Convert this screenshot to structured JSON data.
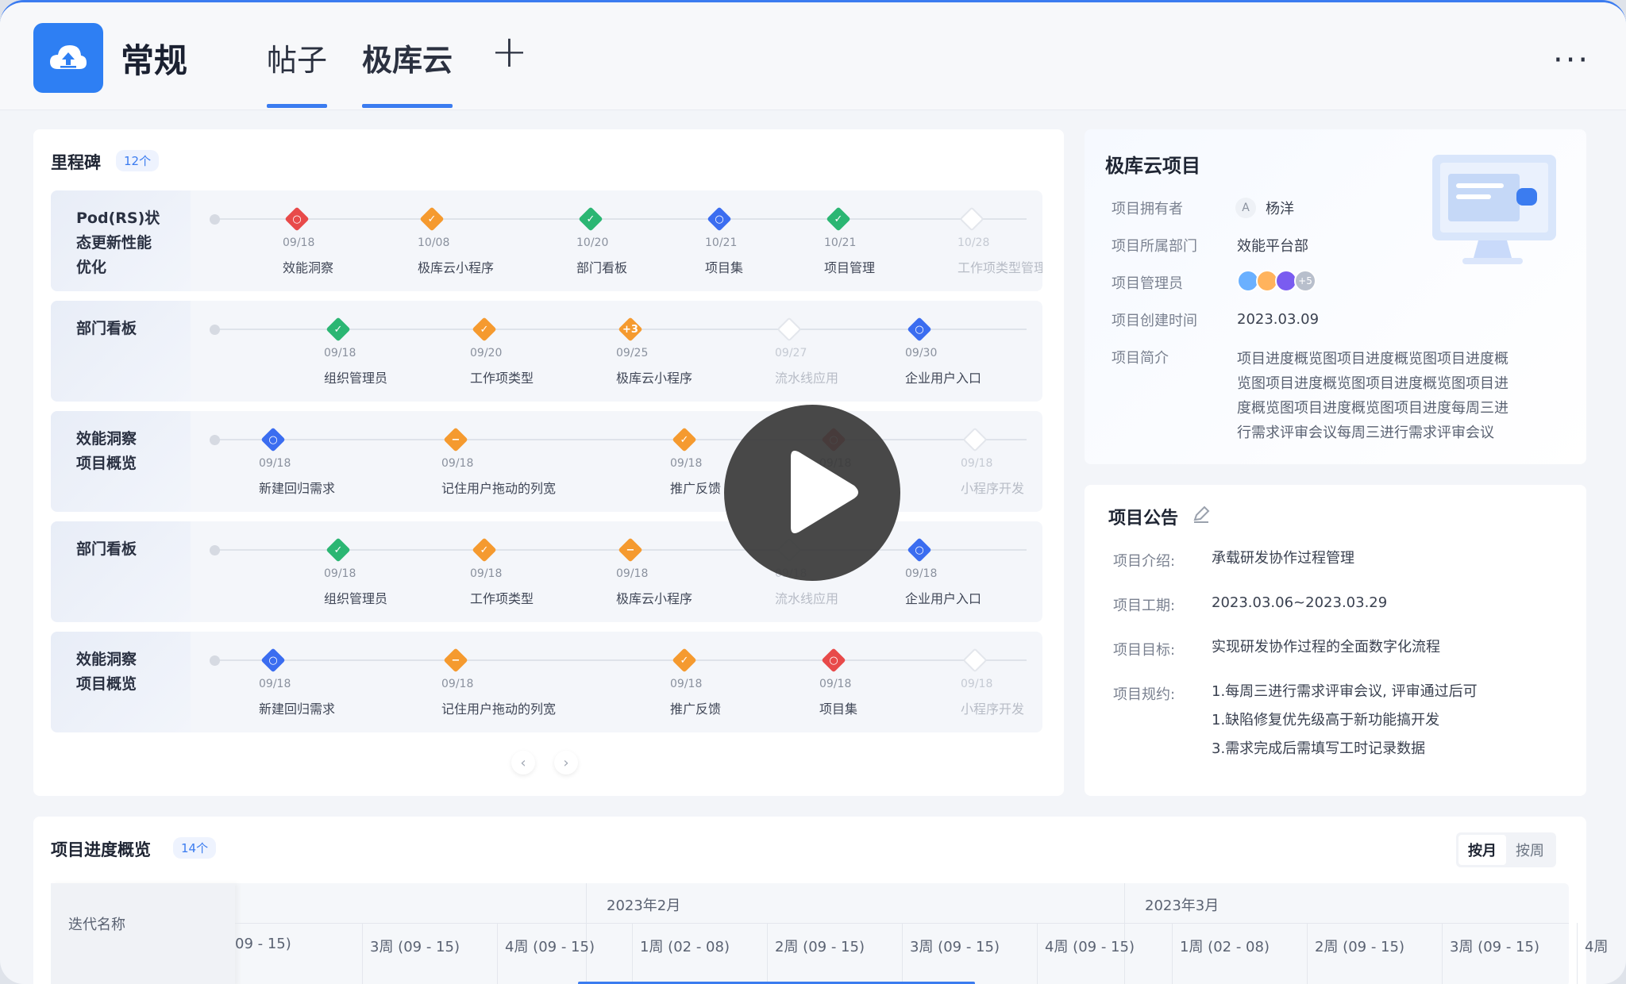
{
  "header": {
    "title": "常规",
    "tabs": [
      {
        "label": "帖子"
      },
      {
        "label": "极库云"
      }
    ],
    "add_label": "+",
    "more_label": "···",
    "brand_color": "#2e7ff3",
    "accent_color": "#3b7cf0"
  },
  "milestones": {
    "title": "里程碑",
    "count": "12个",
    "rows": [
      {
        "label_lines": [
          "Pod(RS)状",
          "态更新性能",
          "优化"
        ],
        "nodes": [
          {
            "date": "09/18",
            "label": "效能洞察",
            "color": "#e84a4a",
            "symbol": "○"
          },
          {
            "date": "10/08",
            "label": "极库云小程序",
            "color": "#f59a2f",
            "symbol": "✓"
          },
          {
            "date": "10/20",
            "label": "部门看板",
            "color": "#2bb673",
            "symbol": "✓"
          },
          {
            "date": "10/21",
            "label": "项目集",
            "color": "#3b6df0",
            "symbol": "○"
          },
          {
            "date": "10/21",
            "label": "项目管理",
            "color": "#2bb673",
            "symbol": "✓"
          },
          {
            "date": "10/28",
            "label": "工作项类型管理",
            "color": "#e3e6ec",
            "symbol": ""
          }
        ]
      },
      {
        "label_lines": [
          "部门看板"
        ],
        "nodes": [
          {
            "date": "09/18",
            "label": "组织管理员",
            "color": "#2bb673",
            "symbol": "✓"
          },
          {
            "date": "09/20",
            "label": "工作项类型",
            "color": "#f59a2f",
            "symbol": "✓"
          },
          {
            "date": "09/25",
            "label": "极库云小程序",
            "color": "#f59a2f",
            "symbol": "+3"
          },
          {
            "date": "09/27",
            "label": "流水线应用",
            "color": "#e3e6ec",
            "symbol": ""
          },
          {
            "date": "09/30",
            "label": "企业用户入口",
            "color": "#3b6df0",
            "symbol": "○"
          }
        ]
      },
      {
        "label_lines": [
          "效能洞察",
          "项目概览"
        ],
        "nodes": [
          {
            "date": "09/18",
            "label": "新建回归需求",
            "color": "#3b6df0",
            "symbol": "○"
          },
          {
            "date": "09/18",
            "label": "记住用户拖动的列宽",
            "color": "#f59a2f",
            "symbol": "−"
          },
          {
            "date": "09/18",
            "label": "推广反馈",
            "color": "#f59a2f",
            "symbol": "✓"
          },
          {
            "date": "09/18",
            "label": "",
            "color": "#e84a4a",
            "symbol": "○"
          },
          {
            "date": "09/18",
            "label": "小程序开发",
            "color": "#e3e6ec",
            "symbol": ""
          }
        ]
      },
      {
        "label_lines": [
          "部门看板"
        ],
        "nodes": [
          {
            "date": "09/18",
            "label": "组织管理员",
            "color": "#2bb673",
            "symbol": "✓"
          },
          {
            "date": "09/18",
            "label": "工作项类型",
            "color": "#f59a2f",
            "symbol": "✓"
          },
          {
            "date": "09/18",
            "label": "极库云小程序",
            "color": "#f59a2f",
            "symbol": "−"
          },
          {
            "date": "09/18",
            "label": "流水线应用",
            "color": "#e3e6ec",
            "symbol": ""
          },
          {
            "date": "09/18",
            "label": "企业用户入口",
            "color": "#3b6df0",
            "symbol": "○"
          }
        ]
      },
      {
        "label_lines": [
          "效能洞察",
          "项目概览"
        ],
        "nodes": [
          {
            "date": "09/18",
            "label": "新建回归需求",
            "color": "#3b6df0",
            "symbol": "○"
          },
          {
            "date": "09/18",
            "label": "记住用户拖动的列宽",
            "color": "#f59a2f",
            "symbol": "−"
          },
          {
            "date": "09/18",
            "label": "推广反馈",
            "color": "#f59a2f",
            "symbol": "✓"
          },
          {
            "date": "09/18",
            "label": "项目集",
            "color": "#e84a4a",
            "symbol": "○"
          },
          {
            "date": "09/18",
            "label": "小程序开发",
            "color": "#e3e6ec",
            "symbol": ""
          }
        ]
      }
    ],
    "prev_label": "‹",
    "next_label": "›"
  },
  "project_info": {
    "title": "极库云项目",
    "owner_key": "项目拥有者",
    "owner_initial": "A",
    "owner_name": "杨洋",
    "dept_key": "项目所属部门",
    "dept_val": "效能平台部",
    "admin_key": "项目管理员",
    "admin_more": "+5",
    "created_key": "项目创建时间",
    "created_val": "2023.03.09",
    "intro_key": "项目简介",
    "intro_lines": [
      "项目进度概览图项目进度概览图项目进度概",
      "览图项目进度概览图项目进度概览图项目进",
      "度概览图项目进度概览图项目进度每周三进",
      "行需求评审会议每周三进行需求评审会议"
    ]
  },
  "notice": {
    "title": "项目公告",
    "rows": [
      {
        "key": "项目介绍:",
        "lines": [
          "承载研发协作过程管理"
        ]
      },
      {
        "key": "项目工期:",
        "lines": [
          "2023.03.06~2023.03.29"
        ]
      },
      {
        "key": "项目目标:",
        "lines": [
          "实现研发协作过程的全面数字化流程"
        ]
      },
      {
        "key": "项目规约:",
        "lines": [
          "1.每周三进行需求评审会议, 评审通过后可",
          "1.缺陷修复优先级高于新功能搞开发",
          "3.需求完成后需填写工时记录数据"
        ]
      }
    ]
  },
  "progress": {
    "title": "项目进度概览",
    "count": "14个",
    "toggle": [
      "按月",
      "按周"
    ],
    "col_header": "迭代名称",
    "months": [
      "2023年2月",
      "2023年3月"
    ],
    "weeks": [
      "09 - 15)",
      "3周 (09 - 15)",
      "4周 (09 - 15)",
      "1周 (02 - 08)",
      "2周 (09 - 15)",
      "3周 (09 - 15)",
      "4周 (09 - 15)",
      "1周 (02 - 08)",
      "2周 (09 - 15)",
      "3周 (09 - 15)",
      "4周"
    ]
  }
}
